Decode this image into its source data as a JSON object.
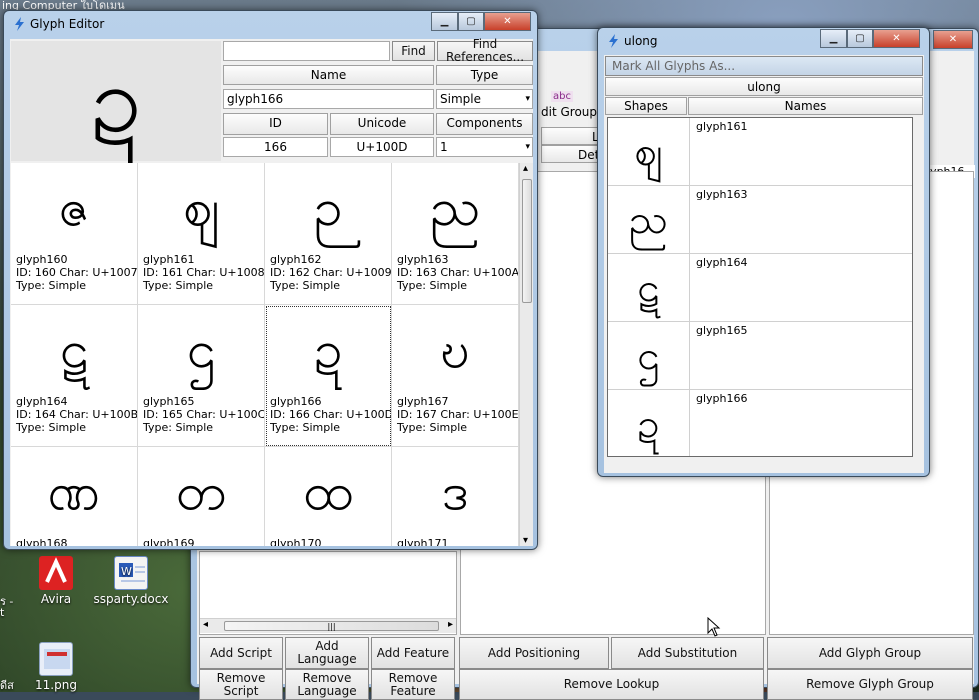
{
  "desktop": {
    "top_strip": "ing   Computer         ใบโดเมน",
    "icons": [
      {
        "label": "Avira"
      },
      {
        "label": "ssparty.docx"
      },
      {
        "label": "11.png"
      }
    ],
    "edge_text": [
      "ร -",
      "t",
      "ดีส"
    ]
  },
  "back_window": {
    "partial_labels": {
      "abc": "abc",
      "edit_group": "dit Group",
      "lo": "Lo",
      "deta": "Deta",
      "glyph16": "lyph16..."
    },
    "buttons": {
      "add_script": "Add Script",
      "add_language": "Add Language",
      "add_feature": "Add Feature",
      "add_positioning": "Add Positioning",
      "add_substitution": "Add Substitution",
      "add_glyph_group": "Add Glyph Group",
      "remove_script": "Remove Script",
      "remove_language": "Remove Language",
      "remove_feature": "Remove Feature",
      "remove_lookup": "Remove Lookup",
      "remove_glyph_group": "Remove Glyph Group"
    },
    "close_glyph": "✕"
  },
  "glyph_editor": {
    "title": "Glyph Editor",
    "preview_glyph": "ဍ",
    "search_value": "",
    "find_label": "Find",
    "find_references_label": "Find References...",
    "name_header": "Name",
    "type_header": "Type",
    "name_value": "glyph166",
    "type_value": "Simple",
    "id_header": "ID",
    "unicode_header": "Unicode",
    "components_header": "Components",
    "id_value": "166",
    "unicode_value": "U+100D",
    "components_value": "1",
    "cells": [
      {
        "glyph": "ဇ",
        "name": "glyph160",
        "meta": "ID: 160  Char: U+1007",
        "type": "Type: Simple"
      },
      {
        "glyph": "ဈ",
        "name": "glyph161",
        "meta": "ID: 161  Char: U+1008",
        "type": "Type: Simple"
      },
      {
        "glyph": "ဉ",
        "name": "glyph162",
        "meta": "ID: 162  Char: U+1009",
        "type": "Type: Simple"
      },
      {
        "glyph": "ည",
        "name": "glyph163",
        "meta": "ID: 163  Char: U+100A",
        "type": "Type: Simple"
      },
      {
        "glyph": "ဋ",
        "name": "glyph164",
        "meta": "ID: 164  Char: U+100B",
        "type": "Type: Simple"
      },
      {
        "glyph": "ဌ",
        "name": "glyph165",
        "meta": "ID: 165  Char: U+100C",
        "type": "Type: Simple"
      },
      {
        "glyph": "ဍ",
        "name": "glyph166",
        "meta": "ID: 166  Char: U+100D",
        "type": "Type: Simple"
      },
      {
        "glyph": "ဎ",
        "name": "glyph167",
        "meta": "ID: 167  Char: U+100E",
        "type": "Type: Simple"
      },
      {
        "glyph": "ဏ",
        "name": "glyph168",
        "meta": "",
        "type": ""
      },
      {
        "glyph": "တ",
        "name": "glyph169",
        "meta": "",
        "type": ""
      },
      {
        "glyph": "ထ",
        "name": "glyph170",
        "meta": "",
        "type": ""
      },
      {
        "glyph": "ဒ",
        "name": "glyph171",
        "meta": "",
        "type": ""
      }
    ],
    "selected_index": 6
  },
  "ulong_window": {
    "title": "ulong",
    "mark_all_label": "Mark All Glyphs As...",
    "group_header": "ulong",
    "shapes_header": "Shapes",
    "names_header": "Names",
    "rows": [
      {
        "glyph": "ဈ",
        "name": "glyph161"
      },
      {
        "glyph": "ည",
        "name": "glyph163"
      },
      {
        "glyph": "ဋ",
        "name": "glyph164"
      },
      {
        "glyph": "ဌ",
        "name": "glyph165"
      },
      {
        "glyph": "ဍ",
        "name": "glyph166"
      }
    ]
  },
  "window_controls": {
    "minimize": "▁",
    "maximize": "▢",
    "close": "✕"
  },
  "icons": {
    "app": "lightning-icon",
    "dropdown": "chevron-down-icon",
    "scroll_left": "◂",
    "scroll_right": "▸",
    "scroll_up": "▴",
    "scroll_down": "▾",
    "grip": "|||"
  }
}
